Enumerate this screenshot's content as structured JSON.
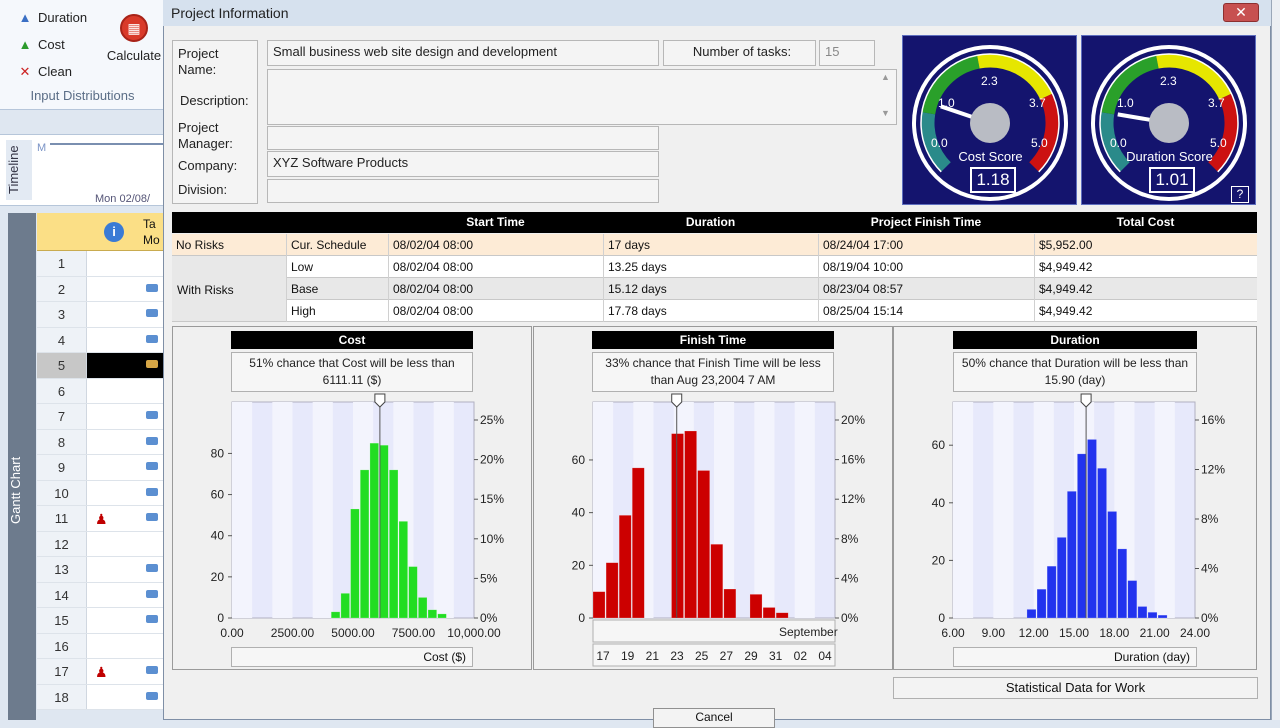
{
  "ribbon": {
    "duration": "Duration",
    "cost": "Cost",
    "clean": "Clean",
    "calculate": "Calculate",
    "group": "Input Distributions"
  },
  "timeline": {
    "label": "Timeline",
    "date": "Mon 02/08/",
    "marker": "M"
  },
  "gantt": {
    "label": "Gantt Chart",
    "header_task": "Ta\nMo",
    "rows": [
      {
        "n": "1",
        "task": false,
        "person": false
      },
      {
        "n": "2",
        "task": true,
        "person": false
      },
      {
        "n": "3",
        "task": true,
        "person": false
      },
      {
        "n": "4",
        "task": true,
        "person": false
      },
      {
        "n": "5",
        "task": true,
        "person": false,
        "selected": true
      },
      {
        "n": "6",
        "task": false,
        "person": false
      },
      {
        "n": "7",
        "task": true,
        "person": false
      },
      {
        "n": "8",
        "task": true,
        "person": false
      },
      {
        "n": "9",
        "task": true,
        "person": false
      },
      {
        "n": "10",
        "task": true,
        "person": false
      },
      {
        "n": "11",
        "task": true,
        "person": true
      },
      {
        "n": "12",
        "task": false,
        "person": false
      },
      {
        "n": "13",
        "task": true,
        "person": false
      },
      {
        "n": "14",
        "task": true,
        "person": false
      },
      {
        "n": "15",
        "task": true,
        "person": false
      },
      {
        "n": "16",
        "task": false,
        "person": false
      },
      {
        "n": "17",
        "task": true,
        "person": true
      },
      {
        "n": "18",
        "task": true,
        "person": false
      }
    ]
  },
  "dialog": {
    "title": "Project Information",
    "close": "✕",
    "labels": {
      "project_name": "Project\nName:",
      "description": "Description:",
      "project_manager": "Project\nManager:",
      "company": "Company:",
      "division": "Division:",
      "num_tasks": "Number of tasks:"
    },
    "values": {
      "project_name": "Small business web site design and development",
      "description": "",
      "project_manager": "",
      "company": "XYZ Software Products",
      "division": "",
      "num_tasks": "15"
    },
    "gauges": [
      {
        "title": "Cost Score",
        "value": "1.18",
        "ticks": [
          "0.0",
          "1.0",
          "2.3",
          "3.7",
          "5.0"
        ],
        "needle": 1.18
      },
      {
        "title": "Duration Score",
        "value": "1.01",
        "ticks": [
          "0.0",
          "1.0",
          "2.3",
          "3.7",
          "5.0"
        ],
        "needle": 1.01
      }
    ],
    "help": "?",
    "table": {
      "headers": [
        "Start Time",
        "Duration",
        "Project Finish Time",
        "Total Cost"
      ],
      "no_risks_label": "No Risks",
      "with_risks_label": "With Risks",
      "rows": [
        {
          "label": "Cur. Schedule",
          "start": "08/02/04 08:00",
          "duration": "17 days",
          "finish": "08/24/04 17:00",
          "cost": "$5,952.00"
        },
        {
          "label": "Low",
          "start": "08/02/04 08:00",
          "duration": "13.25 days",
          "finish": "08/19/04 10:00",
          "cost": "$4,949.42"
        },
        {
          "label": "Base",
          "start": "08/02/04 08:00",
          "duration": "15.12 days",
          "finish": "08/23/04 08:57",
          "cost": "$4,949.42"
        },
        {
          "label": "High",
          "start": "08/02/04 08:00",
          "duration": "17.78 days",
          "finish": "08/25/04 15:14",
          "cost": "$4,949.42"
        }
      ]
    },
    "stat_button": "Statistical Data for Work",
    "cancel_button": "Cancel"
  },
  "colors": {
    "cost": "#22dd22",
    "finish": "#cc0000",
    "duration": "#2233ee",
    "gauge_bg": "#14146e"
  },
  "chart_data": [
    {
      "type": "bar",
      "title": "Cost",
      "note": "51% chance that Cost will be less than 6111.11 ($)",
      "xlabel": "Cost ($)",
      "x_ticks": [
        "0.00",
        "2500.00",
        "5000.00",
        "7500.00",
        "10,000.00"
      ],
      "y_ticks": [
        "0",
        "20",
        "40",
        "60",
        "80"
      ],
      "y2_ticks": [
        "0%",
        "5%",
        "10%",
        "15%",
        "20%",
        "25%"
      ],
      "xlim": [
        0,
        10000
      ],
      "ylim": [
        0,
        105
      ],
      "marker": 6111.11,
      "bins": [
        {
          "x": 4100,
          "v": 3
        },
        {
          "x": 4500,
          "v": 12
        },
        {
          "x": 4900,
          "v": 53
        },
        {
          "x": 5300,
          "v": 72
        },
        {
          "x": 5700,
          "v": 85
        },
        {
          "x": 6100,
          "v": 84
        },
        {
          "x": 6500,
          "v": 72
        },
        {
          "x": 6900,
          "v": 47
        },
        {
          "x": 7300,
          "v": 25
        },
        {
          "x": 7700,
          "v": 10
        },
        {
          "x": 8100,
          "v": 4
        },
        {
          "x": 8500,
          "v": 2
        }
      ],
      "bin_width": 400
    },
    {
      "type": "bar",
      "title": "Finish Time",
      "note": "33% chance that Finish Time will be less than Aug 23,2004 7 AM",
      "x_ticks": [
        "17",
        "19",
        "21",
        "23",
        "25",
        "27",
        "29",
        "31",
        "02",
        "04"
      ],
      "month_label": "September",
      "y_ticks": [
        "0",
        "20",
        "40",
        "60"
      ],
      "y2_ticks": [
        "0%",
        "4%",
        "8%",
        "12%",
        "16%",
        "20%"
      ],
      "xlim": [
        16.5,
        35
      ],
      "ylim": [
        0,
        82
      ],
      "marker": 22.9,
      "bins": [
        {
          "x": 16.5,
          "v": 10
        },
        {
          "x": 17.5,
          "v": 21
        },
        {
          "x": 18.5,
          "v": 39
        },
        {
          "x": 19.5,
          "v": 57
        },
        {
          "x": 22.5,
          "v": 70
        },
        {
          "x": 23.5,
          "v": 71
        },
        {
          "x": 24.5,
          "v": 56
        },
        {
          "x": 25.5,
          "v": 28
        },
        {
          "x": 26.5,
          "v": 11
        },
        {
          "x": 28.5,
          "v": 9
        },
        {
          "x": 29.5,
          "v": 4
        },
        {
          "x": 30.5,
          "v": 2
        }
      ],
      "bin_width": 1
    },
    {
      "type": "bar",
      "title": "Duration",
      "note": "50% chance that Duration will be less than 15.90 (day)",
      "xlabel": "Duration (day)",
      "x_ticks": [
        "6.00",
        "9.00",
        "12.00",
        "15.00",
        "18.00",
        "21.00",
        "24.00"
      ],
      "y_ticks": [
        "0",
        "20",
        "40",
        "60"
      ],
      "y2_ticks": [
        "0%",
        "4%",
        "8%",
        "12%",
        "16%"
      ],
      "xlim": [
        6,
        24
      ],
      "ylim": [
        0,
        75
      ],
      "marker": 15.9,
      "bins": [
        {
          "x": 11.5,
          "v": 3
        },
        {
          "x": 12.25,
          "v": 10
        },
        {
          "x": 13.0,
          "v": 18
        },
        {
          "x": 13.75,
          "v": 28
        },
        {
          "x": 14.5,
          "v": 44
        },
        {
          "x": 15.25,
          "v": 57
        },
        {
          "x": 16.0,
          "v": 62
        },
        {
          "x": 16.75,
          "v": 52
        },
        {
          "x": 17.5,
          "v": 37
        },
        {
          "x": 18.25,
          "v": 24
        },
        {
          "x": 19.0,
          "v": 13
        },
        {
          "x": 19.75,
          "v": 4
        },
        {
          "x": 20.5,
          "v": 2
        },
        {
          "x": 21.25,
          "v": 1
        }
      ],
      "bin_width": 0.75
    }
  ]
}
